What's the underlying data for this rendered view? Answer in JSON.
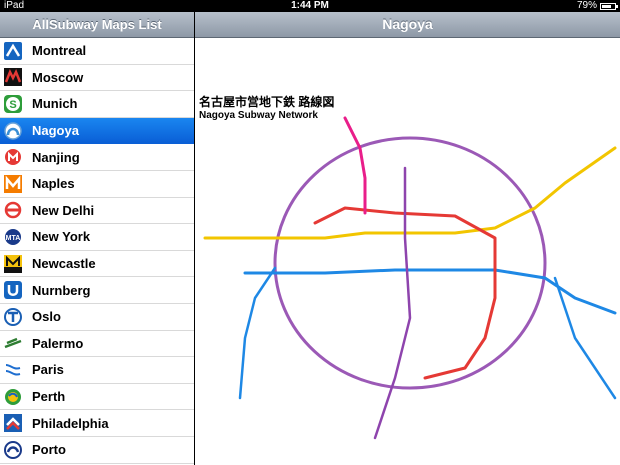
{
  "status": {
    "device": "iPad",
    "time": "1:44 PM",
    "battery": "79%",
    "battery_level": 0.79
  },
  "sidebar": {
    "title": "AllSubway Maps List",
    "items": [
      {
        "label": "Montreal",
        "icon": "montreal-icon",
        "selected": false
      },
      {
        "label": "Moscow",
        "icon": "moscow-icon",
        "selected": false
      },
      {
        "label": "Munich",
        "icon": "munich-icon",
        "selected": false
      },
      {
        "label": "Nagoya",
        "icon": "nagoya-icon",
        "selected": true
      },
      {
        "label": "Nanjing",
        "icon": "nanjing-icon",
        "selected": false
      },
      {
        "label": "Naples",
        "icon": "naples-icon",
        "selected": false
      },
      {
        "label": "New Delhi",
        "icon": "new-delhi-icon",
        "selected": false
      },
      {
        "label": "New York",
        "icon": "new-york-icon",
        "selected": false
      },
      {
        "label": "Newcastle",
        "icon": "newcastle-icon",
        "selected": false
      },
      {
        "label": "Nurnberg",
        "icon": "nurnberg-icon",
        "selected": false
      },
      {
        "label": "Oslo",
        "icon": "oslo-icon",
        "selected": false
      },
      {
        "label": "Palermo",
        "icon": "palermo-icon",
        "selected": false
      },
      {
        "label": "Paris",
        "icon": "paris-icon",
        "selected": false
      },
      {
        "label": "Perth",
        "icon": "perth-icon",
        "selected": false
      },
      {
        "label": "Philadelphia",
        "icon": "philadelphia-icon",
        "selected": false
      },
      {
        "label": "Porto",
        "icon": "porto-icon",
        "selected": false
      }
    ]
  },
  "detail": {
    "title": "Nagoya",
    "map": {
      "title_jp": "名古屋市営地下鉄 路線図",
      "title_en": "Nagoya Subway Network",
      "colors": {
        "higashiyama": "#f2c500",
        "meijo": "#9b59b6",
        "tsurumai": "#1e88e5",
        "sakuradori": "#e53935",
        "kamiiida": "#e91e8a",
        "meiko": "#8e44ad"
      }
    }
  }
}
